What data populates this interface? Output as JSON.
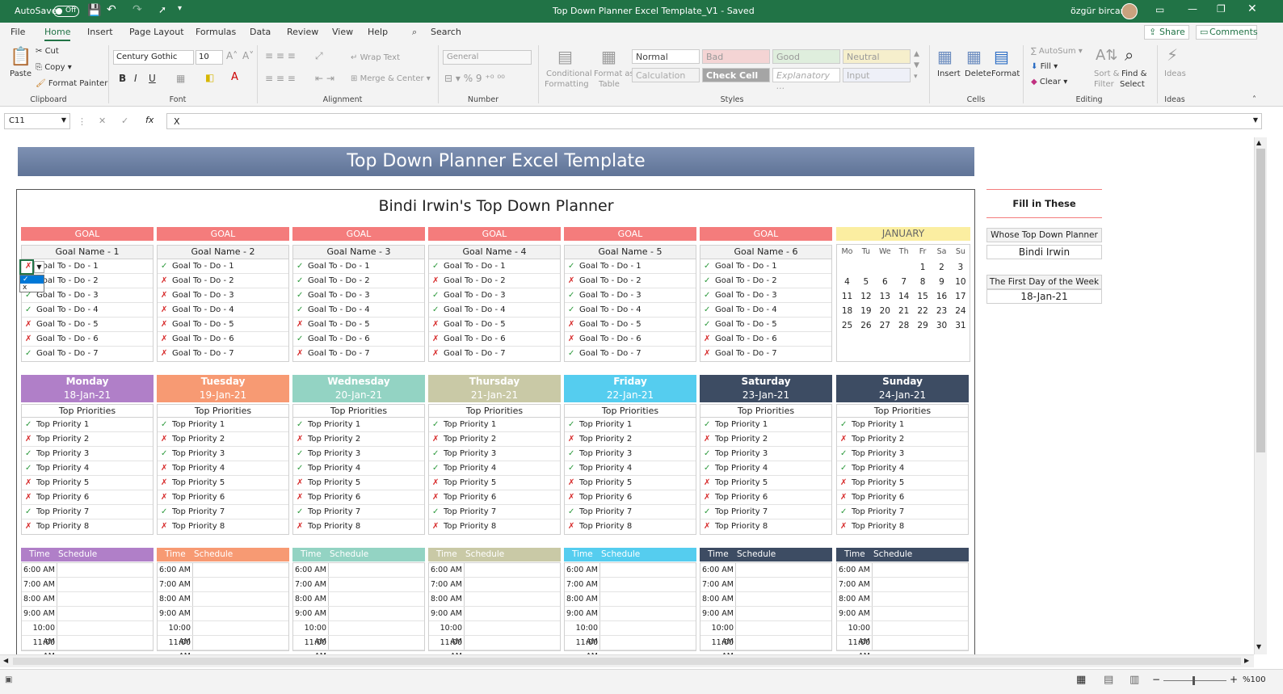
{
  "titlebar": {
    "autosave": "AutoSave",
    "toggle": "Off",
    "doc_title": "Top Down Planner Excel Template_V1  -  Saved",
    "user": "özgür bircan"
  },
  "menu": [
    "File",
    "Home",
    "Insert",
    "Page Layout",
    "Formulas",
    "Data",
    "Review",
    "View",
    "Help"
  ],
  "search": "Search",
  "share": "Share",
  "comments": "Comments",
  "ribbon": {
    "paste": "Paste",
    "cut": "Cut",
    "copy": "Copy",
    "format_painter": "Format Painter",
    "font_name": "Century Gothic",
    "font_size": "10",
    "wrap_text": "Wrap Text",
    "merge": "Merge & Center",
    "number_format": "General",
    "cond_fmt_1": "Conditional",
    "cond_fmt_2": "Formatting",
    "fmt_table_1": "Format as",
    "fmt_table_2": "Table",
    "styles": [
      "Normal",
      "Bad",
      "Good",
      "Neutral",
      "Calculation",
      "Check Cell",
      "Explanatory ...",
      "Input"
    ],
    "insert": "Insert",
    "delete": "Delete",
    "format": "Format",
    "autosum": "AutoSum",
    "fill": "Fill",
    "clear": "Clear",
    "sort_1": "Sort &",
    "sort_2": "Filter",
    "find_1": "Find &",
    "find_2": "Select",
    "ideas": "Ideas",
    "groups": [
      "Clipboard",
      "Font",
      "Alignment",
      "Number",
      "Styles",
      "Cells",
      "Editing",
      "Ideas"
    ]
  },
  "formula_bar": {
    "name_box": "C11",
    "fx": "fx",
    "content": "X"
  },
  "sheet": {
    "banner": "Top Down Planner Excel Template",
    "planner_title": "Bindi Irwin's Top Down Planner",
    "goal_label": "GOAL",
    "goals": [
      {
        "name": "Goal Name - 1",
        "marks": [
          "x",
          "x",
          "ok",
          "ok",
          "x",
          "x",
          "ok"
        ]
      },
      {
        "name": "Goal Name - 2",
        "marks": [
          "ok",
          "x",
          "x",
          "x",
          "x",
          "x",
          "x"
        ]
      },
      {
        "name": "Goal Name - 3",
        "marks": [
          "ok",
          "ok",
          "ok",
          "ok",
          "x",
          "ok",
          "x"
        ]
      },
      {
        "name": "Goal Name - 4",
        "marks": [
          "ok",
          "x",
          "ok",
          "ok",
          "x",
          "x",
          "x"
        ]
      },
      {
        "name": "Goal Name - 5",
        "marks": [
          "ok",
          "x",
          "ok",
          "ok",
          "x",
          "x",
          "ok"
        ]
      },
      {
        "name": "Goal Name - 6",
        "marks": [
          "ok",
          "ok",
          "ok",
          "ok",
          "ok",
          "x",
          "x"
        ]
      }
    ],
    "todo_labels": [
      "Goal To - Do - 1",
      "Goal To - Do - 2",
      "Goal To - Do - 3",
      "Goal To - Do - 4",
      "Goal To - Do - 5",
      "Goal To - Do - 6",
      "Goal To - Do - 7"
    ],
    "dropdown_options": [
      "✓",
      "x"
    ],
    "calendar": {
      "month": "JANUARY",
      "weekdays": [
        "Mo",
        "Tu",
        "We",
        "Th",
        "Fr",
        "Sa",
        "Su"
      ],
      "weeks": [
        [
          "",
          "",
          "",
          "",
          "1",
          "2",
          "3"
        ],
        [
          "4",
          "5",
          "6",
          "7",
          "8",
          "9",
          "10"
        ],
        [
          "11",
          "12",
          "13",
          "14",
          "15",
          "16",
          "17"
        ],
        [
          "18",
          "19",
          "20",
          "21",
          "22",
          "23",
          "24"
        ],
        [
          "25",
          "26",
          "27",
          "28",
          "29",
          "30",
          "31"
        ]
      ]
    },
    "fill_in": {
      "title": "Fill in These",
      "whose_label": "Whose Top Down Planner",
      "whose_value": "Bindi Irwin",
      "first_day_label": "The First Day of the Week",
      "first_day_value": "18-Jan-21"
    },
    "days": [
      {
        "name": "Monday",
        "date": "18-Jan-21",
        "color": "#b07fc8",
        "marks": [
          "ok",
          "x",
          "ok",
          "ok",
          "x",
          "x",
          "ok",
          "x"
        ]
      },
      {
        "name": "Tuesday",
        "date": "19-Jan-21",
        "color": "#f79a73",
        "marks": [
          "ok",
          "x",
          "ok",
          "x",
          "x",
          "x",
          "ok",
          "x"
        ]
      },
      {
        "name": "Wednesday",
        "date": "20-Jan-21",
        "color": "#93d3c3",
        "marks": [
          "ok",
          "x",
          "ok",
          "ok",
          "x",
          "x",
          "ok",
          "x"
        ]
      },
      {
        "name": "Thursday",
        "date": "21-Jan-21",
        "color": "#c9c9a6",
        "marks": [
          "ok",
          "x",
          "ok",
          "ok",
          "x",
          "x",
          "ok",
          "x"
        ]
      },
      {
        "name": "Friday",
        "date": "22-Jan-21",
        "color": "#55cdef",
        "marks": [
          "ok",
          "x",
          "ok",
          "ok",
          "x",
          "x",
          "ok",
          "x"
        ]
      },
      {
        "name": "Saturday",
        "date": "23-Jan-21",
        "color": "#3d4c63",
        "marks": [
          "ok",
          "x",
          "ok",
          "ok",
          "x",
          "x",
          "ok",
          "x"
        ]
      },
      {
        "name": "Sunday",
        "date": "24-Jan-21",
        "color": "#3d4c63",
        "marks": [
          "ok",
          "x",
          "ok",
          "ok",
          "x",
          "x",
          "ok",
          "x"
        ]
      }
    ],
    "top_priorities_label": "Top Priorities",
    "priority_labels": [
      "Top Priority 1",
      "Top Priority 2",
      "Top Priority 3",
      "Top Priority 4",
      "Top Priority 5",
      "Top Priority 6",
      "Top Priority 7",
      "Top Priority 8"
    ],
    "time_label": "Time",
    "schedule_label": "Schedule",
    "times": [
      "6:00 AM",
      "7:00 AM",
      "8:00 AM",
      "9:00 AM",
      "10:00 AM",
      "11:00 AM"
    ]
  },
  "status": {
    "zoom": "%100"
  }
}
